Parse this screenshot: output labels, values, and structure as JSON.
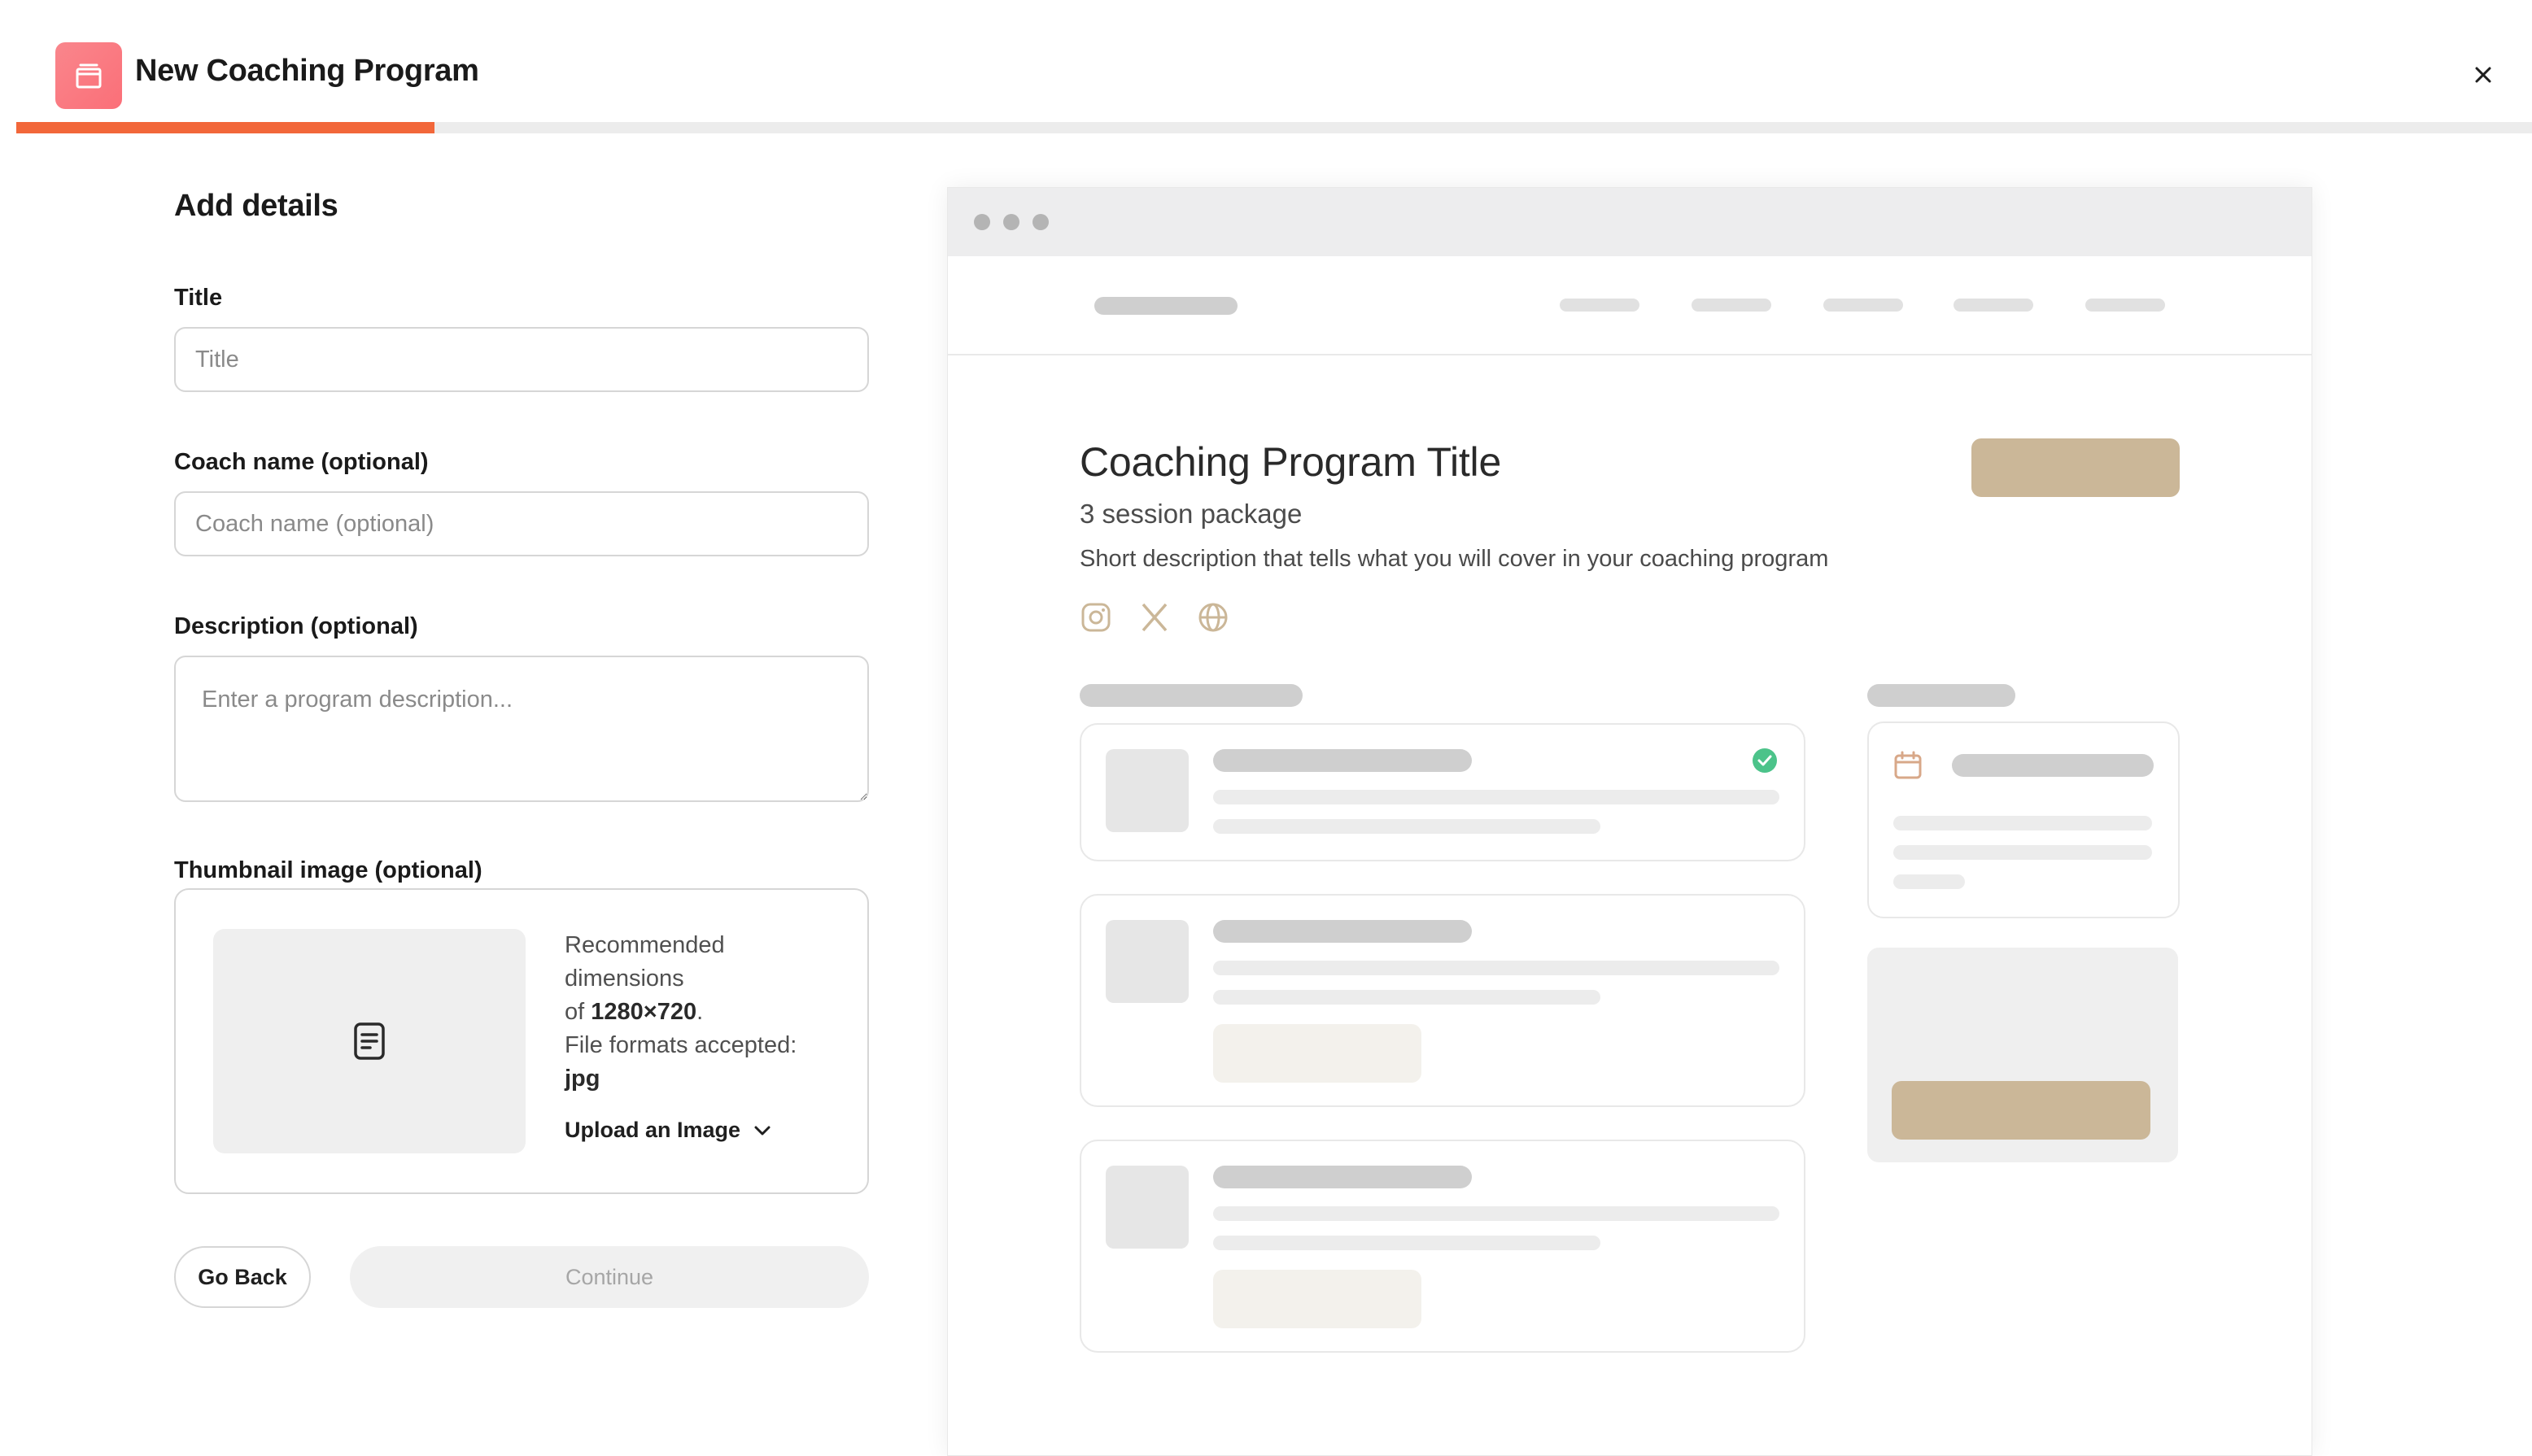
{
  "header": {
    "title": "New Coaching Program",
    "icon": "calendar-stack-icon",
    "close_icon": "close-icon",
    "progress_percent": 16.6,
    "progress_color": "#f2673a",
    "accent_color": "#fb6f78"
  },
  "form": {
    "section_title": "Add details",
    "title_label": "Title",
    "title_placeholder": "Title",
    "title_value": "",
    "coach_label": "Coach name (optional)",
    "coach_placeholder": "Coach name (optional)",
    "coach_value": "",
    "description_label": "Description (optional)",
    "description_placeholder": "Enter a program description...",
    "thumbnail_label": "Thumbnail image (optional)",
    "thumbnail_icon": "document-icon",
    "thumbnail_info": {
      "line1": "Recommended dimensions",
      "line2_prefix": "of ",
      "dimensions": "1280×720",
      "line2_suffix": ".",
      "line3": "File formats accepted:",
      "formats": "jpg"
    },
    "upload_label": "Upload an Image",
    "upload_icon": "chevron-down-icon",
    "back_label": "Go Back",
    "continue_label": "Continue"
  },
  "preview": {
    "title": "Coaching Program Title",
    "subtitle": "3 session package",
    "description": "Short description that tells what you will cover in your coaching program",
    "social_icons": [
      "instagram-icon",
      "x-icon",
      "globe-icon"
    ],
    "cta_color": "#cbb798",
    "check_color": "#4cc38a",
    "calendar_icon_color": "#d8a889"
  }
}
